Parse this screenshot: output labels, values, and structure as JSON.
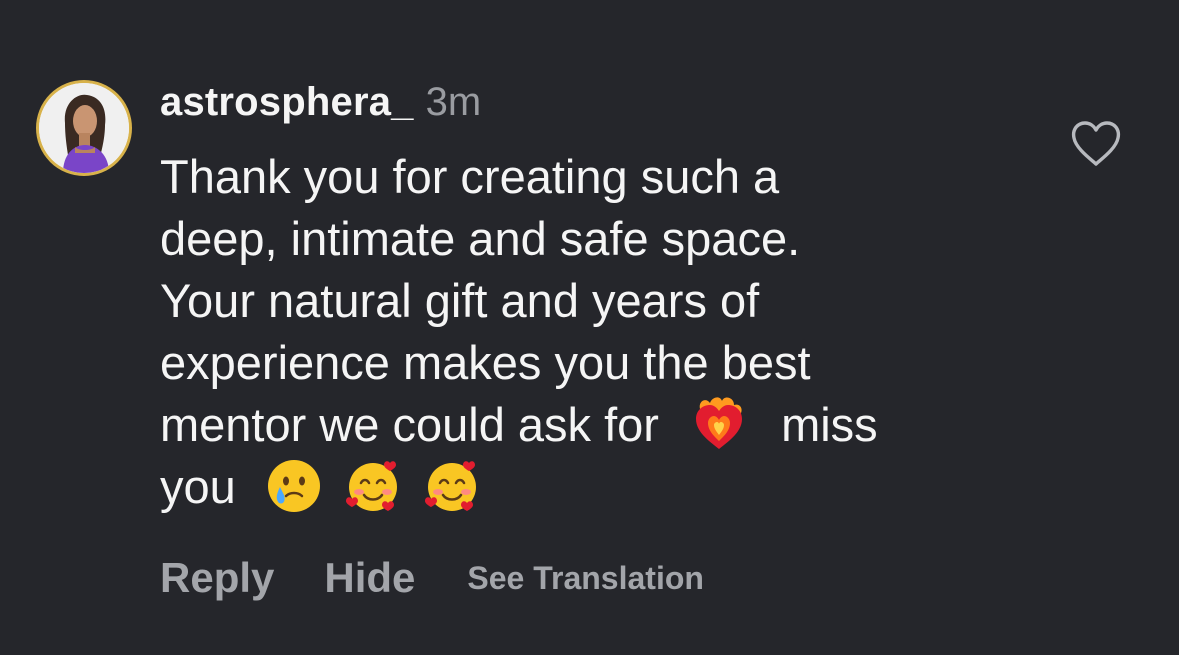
{
  "comment": {
    "username": "astrosphera_",
    "timestamp": "3m",
    "lines": [
      "Thank you for creating such a",
      "deep, intimate and safe space.",
      "Your natural gift and years of",
      "experience makes you the best",
      "mentor we could ask for",
      "miss",
      "you"
    ],
    "emojis": [
      "heart-on-fire",
      "face-holding-back-tears",
      "smiling-face-with-hearts",
      "smiling-face-with-hearts"
    ]
  },
  "actions": {
    "reply": "Reply",
    "hide": "Hide",
    "see_translation": "See Translation"
  },
  "icons": {
    "like": "heart-outline-icon",
    "avatar": "profile-photo"
  },
  "colors": {
    "background": "#25262b",
    "text": "#f5f5f5",
    "muted": "#9a9ca1",
    "avatar_ring": "#d8b24a"
  }
}
